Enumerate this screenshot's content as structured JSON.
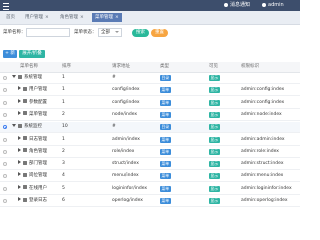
{
  "header": {
    "menu_icon": "hamburger-icon",
    "link1": "消息通知",
    "link2": "admin"
  },
  "tabs": [
    {
      "label": "首页"
    },
    {
      "label": "用户管理"
    },
    {
      "label": "角色管理"
    },
    {
      "label": "菜单管理",
      "active": true
    }
  ],
  "filter": {
    "name_label": "菜单名称：",
    "name_value": "",
    "status_label": "菜单状态：",
    "status_value": "全部",
    "search_btn": "搜索",
    "reset_btn": "重置"
  },
  "toolbar": {
    "add": "+ 新增",
    "expand": "展开/折叠"
  },
  "table": {
    "columns": [
      "菜单名称",
      "排序",
      "请求地址",
      "类型",
      "可见",
      "权限标识"
    ],
    "rows": [
      {
        "name": "系统管理",
        "level": 0,
        "expanded": true,
        "order": "1",
        "url": "#",
        "type": "目录",
        "visible": "显示",
        "perm": ""
      },
      {
        "name": "用户管理",
        "level": 1,
        "expanded": false,
        "order": "1",
        "url": "config/index",
        "type": "菜单",
        "visible": "显示",
        "perm": "admin:config:index"
      },
      {
        "name": "参数配置",
        "level": 1,
        "expanded": false,
        "order": "1",
        "url": "config/index",
        "type": "菜单",
        "visible": "显示",
        "perm": "admin:config:index"
      },
      {
        "name": "菜单管理",
        "level": 1,
        "expanded": false,
        "order": "2",
        "url": "node/index",
        "type": "菜单",
        "visible": "显示",
        "perm": "admin:node:index"
      },
      {
        "name": "系统监控",
        "level": 0,
        "expanded": true,
        "order": "10",
        "url": "#",
        "type": "目录",
        "visible": "显示",
        "perm": "",
        "selected": true
      },
      {
        "name": "日志管理",
        "level": 1,
        "expanded": false,
        "order": "1",
        "url": "admin/index",
        "type": "菜单",
        "visible": "显示",
        "perm": "admin:admin:index"
      },
      {
        "name": "角色管理",
        "level": 1,
        "expanded": false,
        "order": "2",
        "url": "role/index",
        "type": "菜单",
        "visible": "显示",
        "perm": "admin:role:index"
      },
      {
        "name": "部门管理",
        "level": 1,
        "expanded": false,
        "order": "3",
        "url": "struct/index",
        "type": "菜单",
        "visible": "显示",
        "perm": "admin:struct:index"
      },
      {
        "name": "岗位管理",
        "level": 1,
        "expanded": false,
        "order": "4",
        "url": "menu/index",
        "type": "菜单",
        "visible": "显示",
        "perm": "admin:menu:index"
      },
      {
        "name": "在线用户",
        "level": 1,
        "expanded": false,
        "order": "5",
        "url": "logininfor/index",
        "type": "菜单",
        "visible": "显示",
        "perm": "admin:logininfor:index"
      },
      {
        "name": "登录日志",
        "level": 1,
        "expanded": false,
        "order": "6",
        "url": "operlog/index",
        "type": "菜单",
        "visible": "显示",
        "perm": "admin:operlog:index"
      }
    ]
  }
}
